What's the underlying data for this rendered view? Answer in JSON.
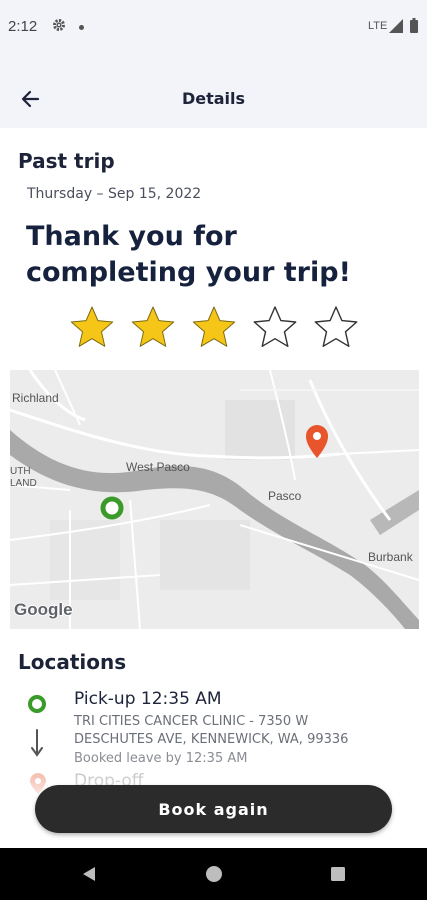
{
  "status_bar": {
    "time": "2:12",
    "network": "LTE",
    "icons": [
      "gear-icon",
      "notification-dot-icon",
      "signal-icon",
      "battery-icon"
    ]
  },
  "app_bar": {
    "title": "Details",
    "back_icon": "arrow-left-icon"
  },
  "trip": {
    "section_title": "Past trip",
    "date": "Thursday – Sep 15, 2022",
    "headline": "Thank you for completing your trip!",
    "rating": {
      "value": 3,
      "max": 5
    },
    "star_filled_color": "#f5c518"
  },
  "map": {
    "labels": {
      "richland": "Richland",
      "west_pasco": "West Pasco",
      "pasco": "Pasco",
      "burbank": "Burbank",
      "south_highlands_1": "UTH",
      "south_highlands_2": "LAND"
    },
    "attribution": "Google",
    "pickup_marker_color": "#3a9a2a",
    "dropoff_marker_color": "#e8542c"
  },
  "locations": {
    "section_title": "Locations",
    "pickup": {
      "title": "Pick-up 12:35 AM",
      "address": "TRI CITIES CANCER CLINIC - 7350 W DESCHUTES AVE, KENNEWICK, WA, 99336",
      "booked": "Booked leave by 12:35 AM"
    },
    "dropoff": {
      "title": "Drop-off"
    }
  },
  "actions": {
    "book_again": "Book again"
  },
  "nav_bar": {
    "icons": [
      "nav-back-icon",
      "nav-home-icon",
      "nav-recent-apps-icon"
    ]
  }
}
